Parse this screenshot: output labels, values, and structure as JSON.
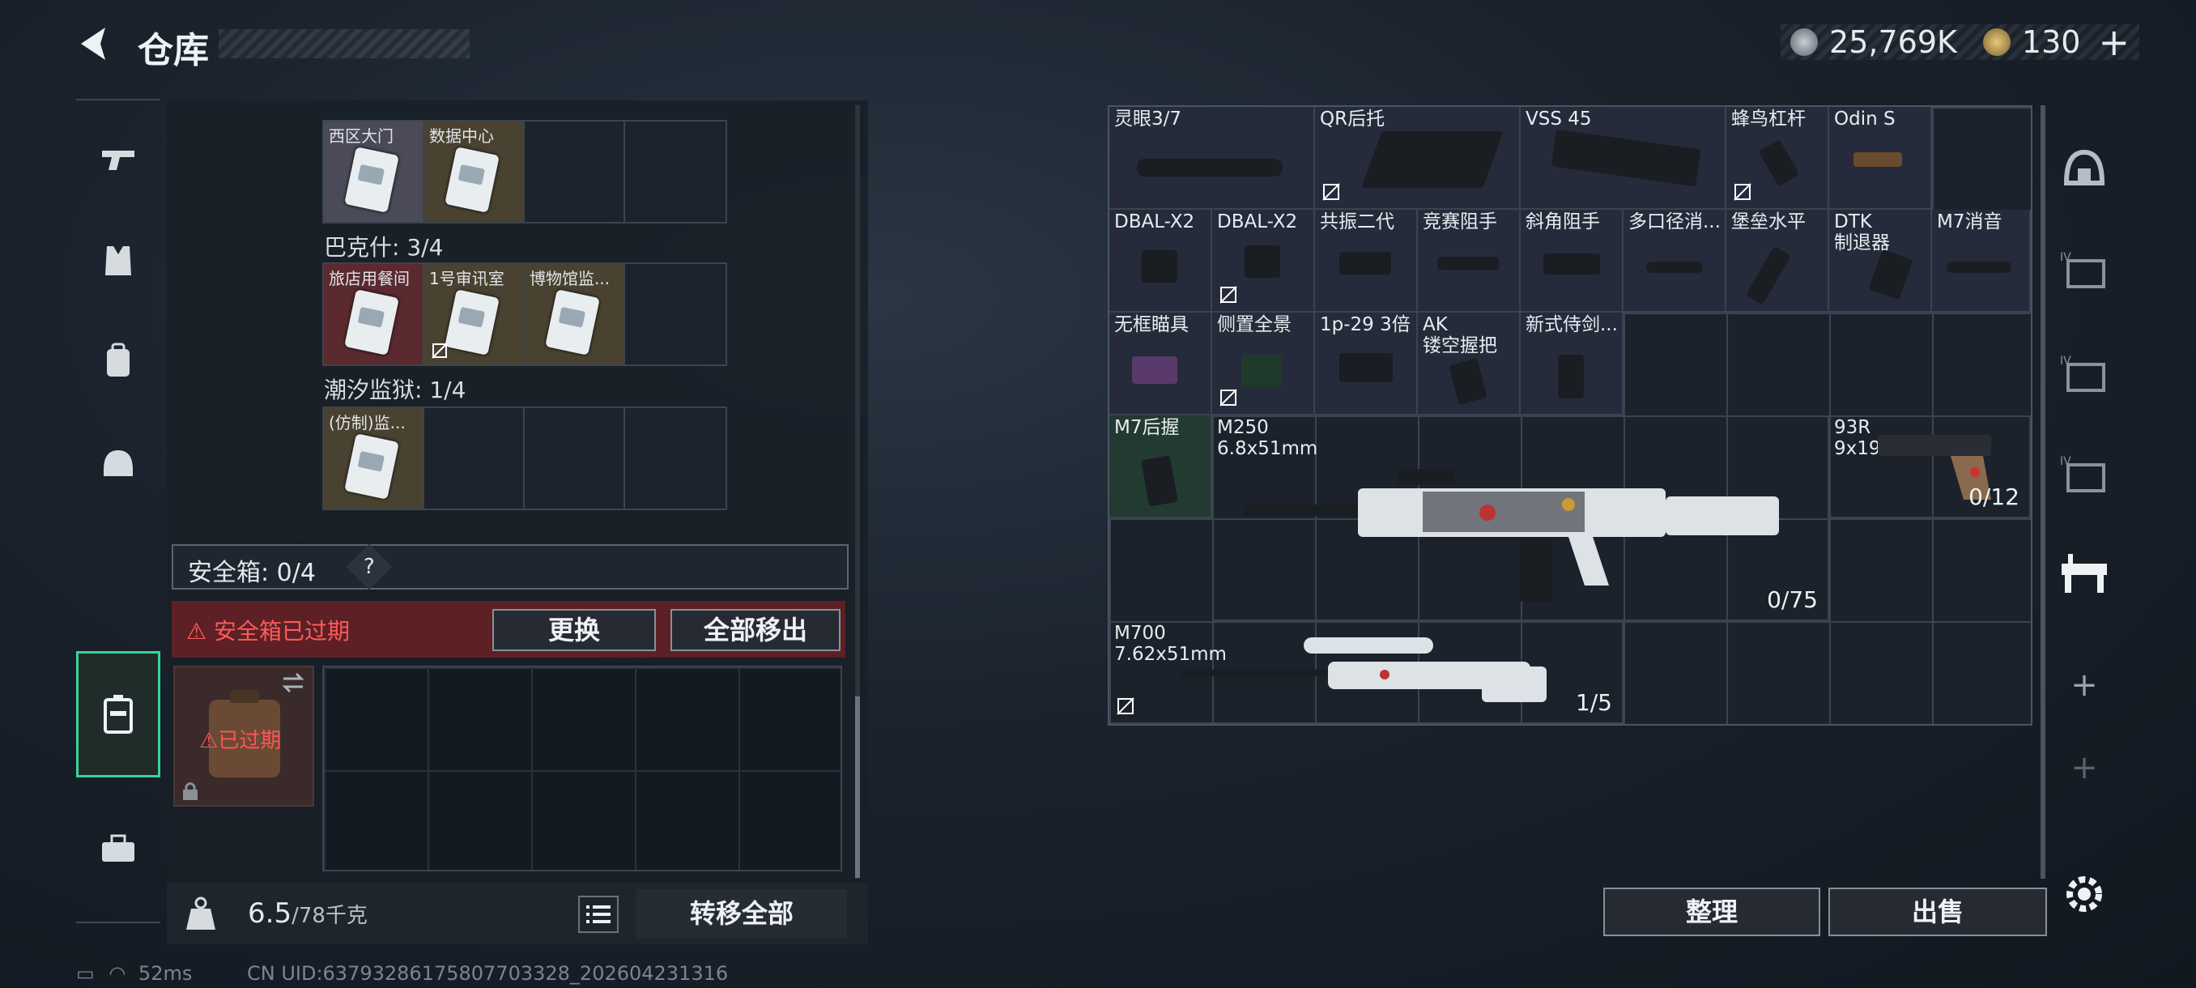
{
  "header": {
    "title": "仓库",
    "back_icon": "back-arrow-icon"
  },
  "currency": [
    {
      "icon": "silver-coin-icon",
      "value": "25,769K",
      "color": "#9aa3ad"
    },
    {
      "icon": "gold-coin-icon",
      "value": "130",
      "color": "#c9a860"
    }
  ],
  "currency_plus": "+",
  "left_nav": [
    {
      "name": "weapons",
      "icon": "gun-icon",
      "active": false
    },
    {
      "name": "armor",
      "icon": "vest-icon",
      "active": false
    },
    {
      "name": "backpack",
      "icon": "backpack-icon",
      "active": false
    },
    {
      "name": "helmet",
      "icon": "helmet-icon",
      "active": false
    },
    {
      "name": "safebox",
      "icon": "case-icon",
      "active": true
    },
    {
      "name": "toolbox",
      "icon": "toolbox-icon",
      "active": false
    }
  ],
  "key_groups": [
    {
      "label": "",
      "items": [
        "西区大门",
        "数据中心",
        "",
        ""
      ]
    },
    {
      "label": "巴克什: 3/4",
      "items": [
        "旅店用餐间",
        "1号审讯室",
        "博物馆监...",
        ""
      ]
    },
    {
      "label": "潮汐监狱: 1/4",
      "items": [
        "(仿制)监...",
        "",
        "",
        ""
      ]
    }
  ],
  "safebox": {
    "title": "安全箱: 0/4",
    "help": "?",
    "expired_text": "安全箱已过期",
    "swap_label": "更换",
    "move_all_label": "全部移出",
    "case_status": "已过期"
  },
  "bottom": {
    "weight": "6.5",
    "weight_max": "/78千克",
    "transfer_label": "转移全部"
  },
  "status": {
    "ping": "52ms",
    "uid": "CN UID:6379328617580770332​8_202604231316"
  },
  "stash_items": [
    {
      "name": "灵眼3/7",
      "count": ""
    },
    {
      "name": "QR后托",
      "count": ""
    },
    {
      "name": "VSS 45",
      "count": ""
    },
    {
      "name": "蜂鸟杠杆",
      "count": ""
    },
    {
      "name": "Odin S",
      "count": ""
    },
    {
      "name": "DBAL-X2",
      "count": ""
    },
    {
      "name": "DBAL-X2",
      "count": ""
    },
    {
      "name": "共振二代",
      "count": ""
    },
    {
      "name": "竞赛阻手",
      "count": ""
    },
    {
      "name": "斜角阻手",
      "count": ""
    },
    {
      "name": "多口径消...",
      "count": ""
    },
    {
      "name": "堡垒水平",
      "count": ""
    },
    {
      "name": "DTK\n制退器",
      "count": ""
    },
    {
      "name": "M7消音",
      "count": ""
    },
    {
      "name": "无框瞄具",
      "count": ""
    },
    {
      "name": "侧置全景",
      "count": ""
    },
    {
      "name": "1p-29 3倍",
      "count": ""
    },
    {
      "name": "AK\n镂空握把",
      "count": ""
    },
    {
      "name": "新式侍剑...",
      "count": ""
    },
    {
      "name": "M7后握",
      "count": ""
    },
    {
      "name": "M250\n6.8x51mm",
      "count": "0/75"
    },
    {
      "name": "93R\n9x19mm",
      "count": "0/12"
    },
    {
      "name": "M700\n7.62x51mm",
      "count": "1/5"
    }
  ],
  "right_tabs": [
    {
      "icon": "helmet-outline-icon"
    },
    {
      "icon": "safe-box-iv-icon",
      "label": "IV"
    },
    {
      "icon": "safe-box-iv-icon",
      "label": "IV"
    },
    {
      "icon": "safe-box-iv-icon",
      "label": "IV"
    },
    {
      "icon": "workbench-icon"
    },
    {
      "icon": "add-icon",
      "label": "+"
    },
    {
      "icon": "add-icon",
      "label": "+"
    }
  ],
  "actions": {
    "sort_label": "整理",
    "sell_label": "出售"
  }
}
